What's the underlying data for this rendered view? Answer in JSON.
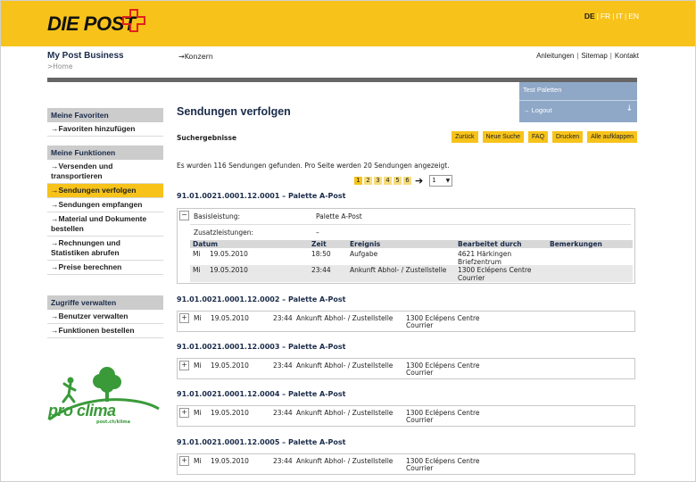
{
  "header": {
    "logo_text": "DIE POST",
    "languages": [
      "DE",
      "FR",
      "IT",
      "EN"
    ],
    "active_language": "DE",
    "brand": "My Post Business",
    "breadcrumb_home": ">Home",
    "konzern_link": "→Konzern",
    "links": [
      "Anleitungen",
      "Sitemap",
      "Kontakt"
    ]
  },
  "user": {
    "name": "Test Paletten",
    "logout": "→ Logout",
    "arrow_icon": "arrow-down-icon"
  },
  "sidebar": {
    "favorites_head": "Meine Favoriten",
    "favorites_items": [
      "→Favoriten hinzufügen"
    ],
    "functions_head": "Meine Funktionen",
    "functions_items": [
      {
        "label": "→Versenden und transportieren",
        "active": false
      },
      {
        "label": "→Sendungen verfolgen",
        "active": true
      },
      {
        "label": "→Sendungen empfangen",
        "active": false
      },
      {
        "label": "→Material und Dokumente bestellen",
        "active": false
      },
      {
        "label": "→Rechnungen und Statistiken abrufen",
        "active": false
      },
      {
        "label": "→Preise berechnen",
        "active": false
      }
    ],
    "access_head": "Zugriffe verwalten",
    "access_items": [
      "→Benutzer verwalten",
      "→Funktionen bestellen"
    ]
  },
  "proclima": {
    "text": "pro clima",
    "sub": "post.ch/klima"
  },
  "main": {
    "title": "Sendungen verfolgen",
    "results_label": "Suchergebnisse",
    "actions": [
      "Zurück",
      "Neue Suche",
      "FAQ",
      "Drucken",
      "Alle aufklappen"
    ],
    "info": "Es wurden 116 Sendungen gefunden. Pro Seite werden 20 Sendungen angezeigt.",
    "pages": [
      "1",
      "2",
      "3",
      "4",
      "5",
      "6"
    ],
    "current_page": "1",
    "page_select": "1"
  },
  "shipments": [
    {
      "title": "91.01.0021.0001.12.0001 – Palette A-Post",
      "expanded": true,
      "toggle": "−",
      "base_label": "Basisleistung:",
      "base_value": "Palette A-Post",
      "extra_label": "Zusatzleistungen:",
      "extra_value": "–",
      "columns": [
        "Datum",
        "Zeit",
        "Ereignis",
        "Bearbeitet durch",
        "Bemerkungen"
      ],
      "events": [
        {
          "day": "Mi",
          "date": "19.05.2010",
          "time": "18:50",
          "event": "Aufgabe",
          "by_1": "4621 Härkingen",
          "by_2": "Briefzentrum"
        },
        {
          "day": "Mi",
          "date": "19.05.2010",
          "time": "23:44",
          "event": "Ankunft Abhol- / Zustellstelle",
          "by_1": "1300 Eclépens Centre",
          "by_2": "Courrier"
        }
      ]
    },
    {
      "title": "91.01.0021.0001.12.0002 – Palette A-Post",
      "toggle": "+",
      "day": "Mi",
      "date": "19.05.2010",
      "time": "23:44",
      "event": "Ankunft Abhol- / Zustellstelle",
      "by_1": "1300 Eclépens Centre",
      "by_2": "Courrier"
    },
    {
      "title": "91.01.0021.0001.12.0003 – Palette A-Post",
      "toggle": "+",
      "day": "Mi",
      "date": "19.05.2010",
      "time": "23:44",
      "event": "Ankunft Abhol- / Zustellstelle",
      "by_1": "1300 Eclépens Centre",
      "by_2": "Courrier"
    },
    {
      "title": "91.01.0021.0001.12.0004 – Palette A-Post",
      "toggle": "+",
      "day": "Mi",
      "date": "19.05.2010",
      "time": "23:44",
      "event": "Ankunft Abhol- / Zustellstelle",
      "by_1": "1300 Eclépens Centre",
      "by_2": "Courrier"
    },
    {
      "title": "91.01.0021.0001.12.0005 – Palette A-Post",
      "toggle": "+",
      "day": "Mi",
      "date": "19.05.2010",
      "time": "23:44",
      "event": "Ankunft Abhol- / Zustellstelle",
      "by_1": "1300 Eclépens Centre",
      "by_2": "Courrier"
    }
  ],
  "colors": {
    "accent": "#f7c31a",
    "navy": "#1a2b4a",
    "user_box": "#8fa8c8",
    "pro_clima_green": "#3a9a3a"
  }
}
